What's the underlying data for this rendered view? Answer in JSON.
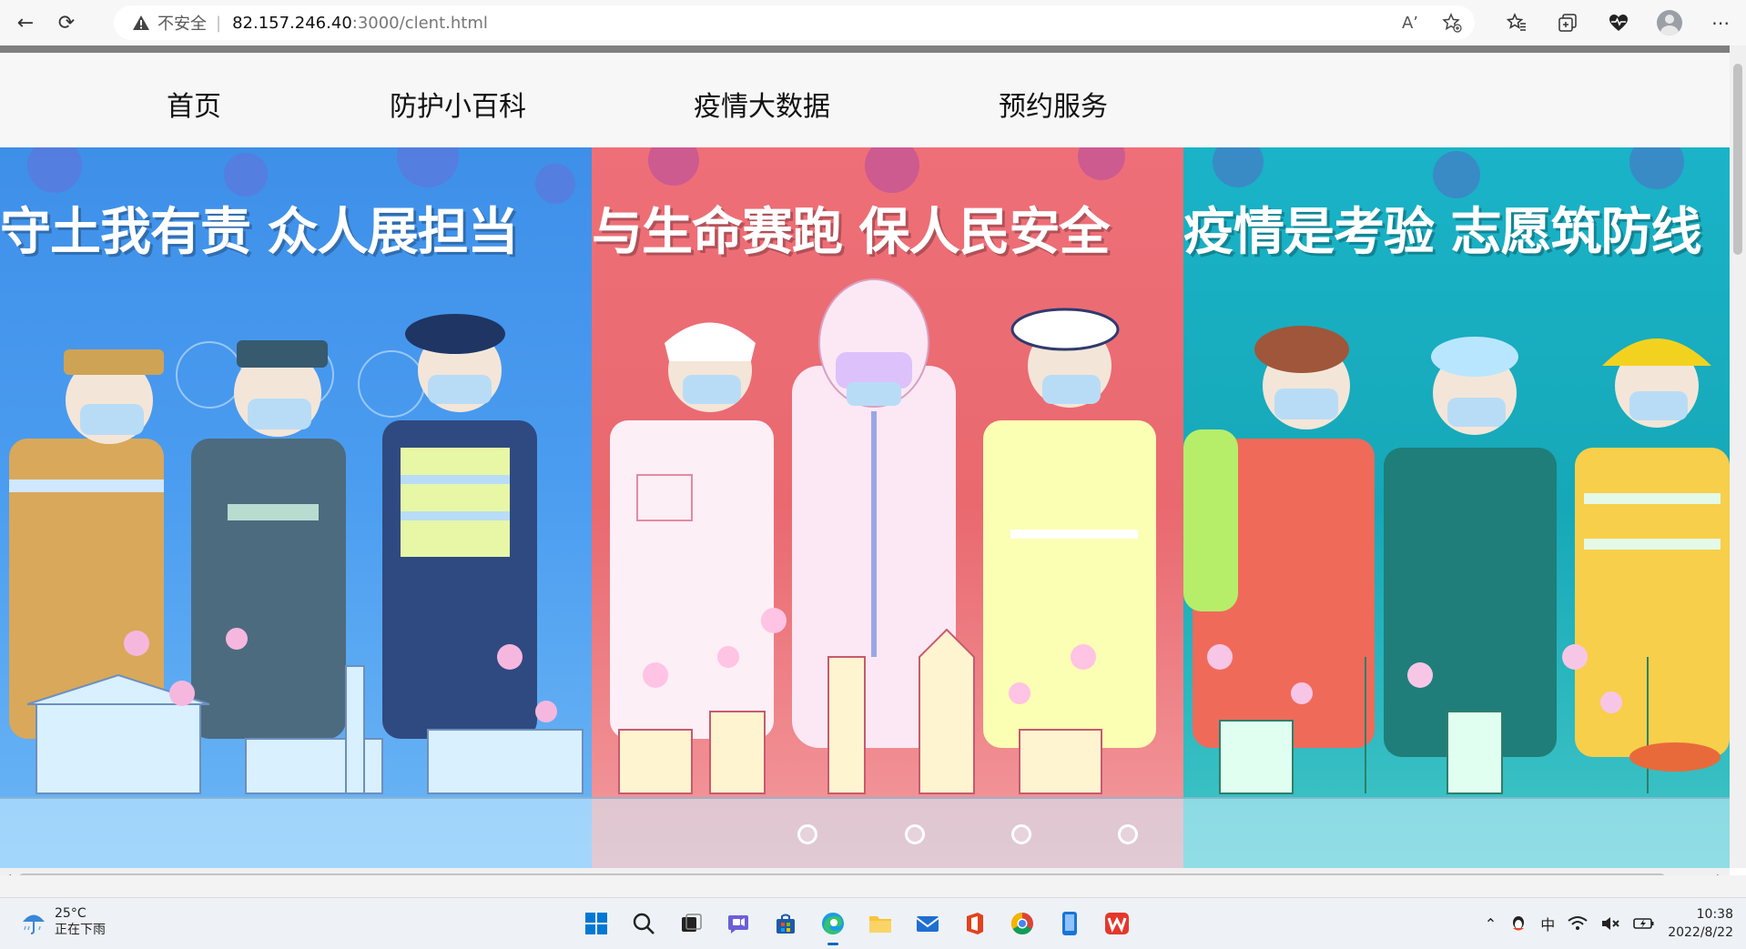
{
  "browser": {
    "back": "←",
    "reload": "⟳",
    "insecure_label": "不安全",
    "separator": "|",
    "url_host": "82.157.246.40",
    "url_rest": ":3000/clent.html",
    "read_aloud": "Aʼ",
    "more": "⋯"
  },
  "nav": {
    "items": [
      "首页",
      "防护小百科",
      "疫情大数据",
      "预约服务"
    ]
  },
  "banner": {
    "slogans": [
      "守土我有责 众人展担当",
      "与生命赛跑 保人民安全",
      "疫情是考验 志愿筑防线"
    ],
    "colors": [
      "#3e8fe8",
      "#ef6f78",
      "#1ab3c8"
    ],
    "carousel_dots": 4
  },
  "taskbar": {
    "temperature": "25°C",
    "weather": "正在下雨",
    "ime": "中",
    "time": "10:38",
    "date": "2022/8/22"
  }
}
